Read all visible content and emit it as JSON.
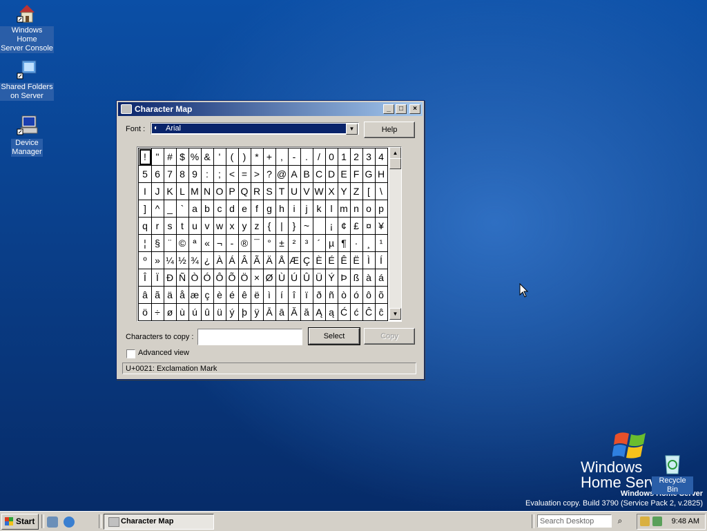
{
  "desktop": {
    "icons": [
      {
        "label_line1": "Windows Home",
        "label_line2": "Server Console"
      },
      {
        "label_line1": "Shared Folders",
        "label_line2": "on Server"
      },
      {
        "label_line1": "Device",
        "label_line2": "Manager"
      }
    ],
    "recycle_bin": "Recycle Bin",
    "branding": {
      "line1": "Windows",
      "line2": "Home Server",
      "product": "Windows Home Server",
      "build": "Evaluation copy. Build 3790 (Service Pack 2, v.2825)"
    }
  },
  "window": {
    "title": "Character Map",
    "font_label": "Font :",
    "font_value": "Arial",
    "help_button": "Help",
    "characters": [
      "!",
      "\"",
      "#",
      "$",
      "%",
      "&",
      "'",
      "(",
      ")",
      "*",
      "+",
      ",",
      "-",
      ".",
      "/",
      "0",
      "1",
      "2",
      "3",
      "4",
      "5",
      "6",
      "7",
      "8",
      "9",
      ":",
      ";",
      "<",
      "=",
      ">",
      "?",
      "@",
      "A",
      "B",
      "C",
      "D",
      "E",
      "F",
      "G",
      "H",
      "I",
      "J",
      "K",
      "L",
      "M",
      "N",
      "O",
      "P",
      "Q",
      "R",
      "S",
      "T",
      "U",
      "V",
      "W",
      "X",
      "Y",
      "Z",
      "[",
      "\\",
      "]",
      "^",
      "_",
      "`",
      "a",
      "b",
      "c",
      "d",
      "e",
      "f",
      "g",
      "h",
      "i",
      "j",
      "k",
      "l",
      "m",
      "n",
      "o",
      "p",
      "q",
      "r",
      "s",
      "t",
      "u",
      "v",
      "w",
      "x",
      "y",
      "z",
      "{",
      "|",
      "}",
      "~",
      " ",
      "¡",
      "¢",
      "£",
      "¤",
      "¥",
      "¦",
      "§",
      "¨",
      "©",
      "ª",
      "«",
      "¬",
      "-",
      "®",
      "¯",
      "°",
      "±",
      "²",
      "³",
      "´",
      "µ",
      "¶",
      "·",
      "¸",
      "¹",
      "º",
      "»",
      "¼",
      "½",
      "¾",
      "¿",
      "À",
      "Á",
      "Â",
      "Ã",
      "Ä",
      "Å",
      "Æ",
      "Ç",
      "È",
      "É",
      "Ê",
      "Ë",
      "Ì",
      "Í",
      "Î",
      "Ï",
      "Ð",
      "Ñ",
      "Ò",
      "Ó",
      "Ô",
      "Õ",
      "Ö",
      "×",
      "Ø",
      "Ù",
      "Ú",
      "Û",
      "Ü",
      "Ý",
      "Þ",
      "ß",
      "à",
      "á",
      "â",
      "ã",
      "ä",
      "å",
      "æ",
      "ç",
      "è",
      "é",
      "ê",
      "ë",
      "ì",
      "í",
      "î",
      "ï",
      "ð",
      "ñ",
      "ò",
      "ó",
      "ô",
      "õ",
      "ö",
      "÷",
      "ø",
      "ù",
      "ú",
      "û",
      "ü",
      "ý",
      "þ",
      "ÿ",
      "Ā",
      "ā",
      "Ă",
      "ă",
      "Ą",
      "ą",
      "Ć",
      "ć",
      "Ĉ",
      "ĉ"
    ],
    "chars_to_copy_label": "Characters to copy :",
    "chars_to_copy_value": "",
    "select_button": "Select",
    "copy_button": "Copy",
    "advanced_view_label": "Advanced view",
    "status": "U+0021: Exclamation Mark"
  },
  "taskbar": {
    "start": "Start",
    "task_button": "Character Map",
    "search_placeholder": "Search Desktop",
    "clock": "9:48 AM"
  }
}
